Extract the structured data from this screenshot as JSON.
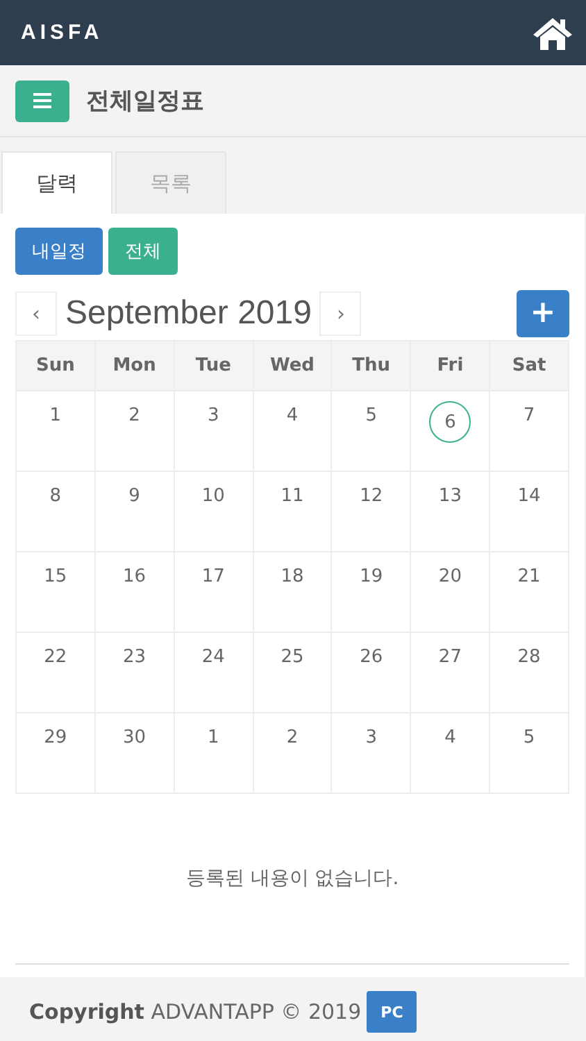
{
  "header": {
    "logo": "AISFA"
  },
  "title_bar": {
    "title": "전체일정표"
  },
  "tabs": [
    {
      "label": "달력",
      "selected": true
    },
    {
      "label": "목록",
      "selected": false
    }
  ],
  "filters": [
    {
      "label": "내일정",
      "color": "#3a80c8"
    },
    {
      "label": "전체",
      "color": "#3bb08f"
    }
  ],
  "calendar": {
    "prev": "‹",
    "month": "September 2019",
    "next": "›",
    "add": "+",
    "weekdays": [
      "Sun",
      "Mon",
      "Tue",
      "Wed",
      "Thu",
      "Fri",
      "Sat"
    ],
    "weeks": [
      [
        {
          "day": "1",
          "today": false
        },
        {
          "day": "2",
          "today": false
        },
        {
          "day": "3",
          "today": false
        },
        {
          "day": "4",
          "today": false
        },
        {
          "day": "5",
          "today": false
        },
        {
          "day": "6",
          "today": true
        },
        {
          "day": "7",
          "today": false
        }
      ],
      [
        {
          "day": "8",
          "today": false
        },
        {
          "day": "9",
          "today": false
        },
        {
          "day": "10",
          "today": false
        },
        {
          "day": "11",
          "today": false
        },
        {
          "day": "12",
          "today": false
        },
        {
          "day": "13",
          "today": false
        },
        {
          "day": "14",
          "today": false
        }
      ],
      [
        {
          "day": "15",
          "today": false
        },
        {
          "day": "16",
          "today": false
        },
        {
          "day": "17",
          "today": false
        },
        {
          "day": "18",
          "today": false
        },
        {
          "day": "19",
          "today": false
        },
        {
          "day": "20",
          "today": false
        },
        {
          "day": "21",
          "today": false
        }
      ],
      [
        {
          "day": "22",
          "today": false
        },
        {
          "day": "23",
          "today": false
        },
        {
          "day": "24",
          "today": false
        },
        {
          "day": "25",
          "today": false
        },
        {
          "day": "26",
          "today": false
        },
        {
          "day": "27",
          "today": false
        },
        {
          "day": "28",
          "today": false
        }
      ],
      [
        {
          "day": "29",
          "today": false
        },
        {
          "day": "30",
          "today": false
        },
        {
          "day": "1",
          "today": false
        },
        {
          "day": "2",
          "today": false
        },
        {
          "day": "3",
          "today": false
        },
        {
          "day": "4",
          "today": false
        },
        {
          "day": "5",
          "today": false
        }
      ]
    ]
  },
  "empty_message": "등록된 내용이 없습니다.",
  "footer": {
    "copyright": "**Copyright** ADVANTAPP © 2019",
    "pc_button": "PC"
  }
}
